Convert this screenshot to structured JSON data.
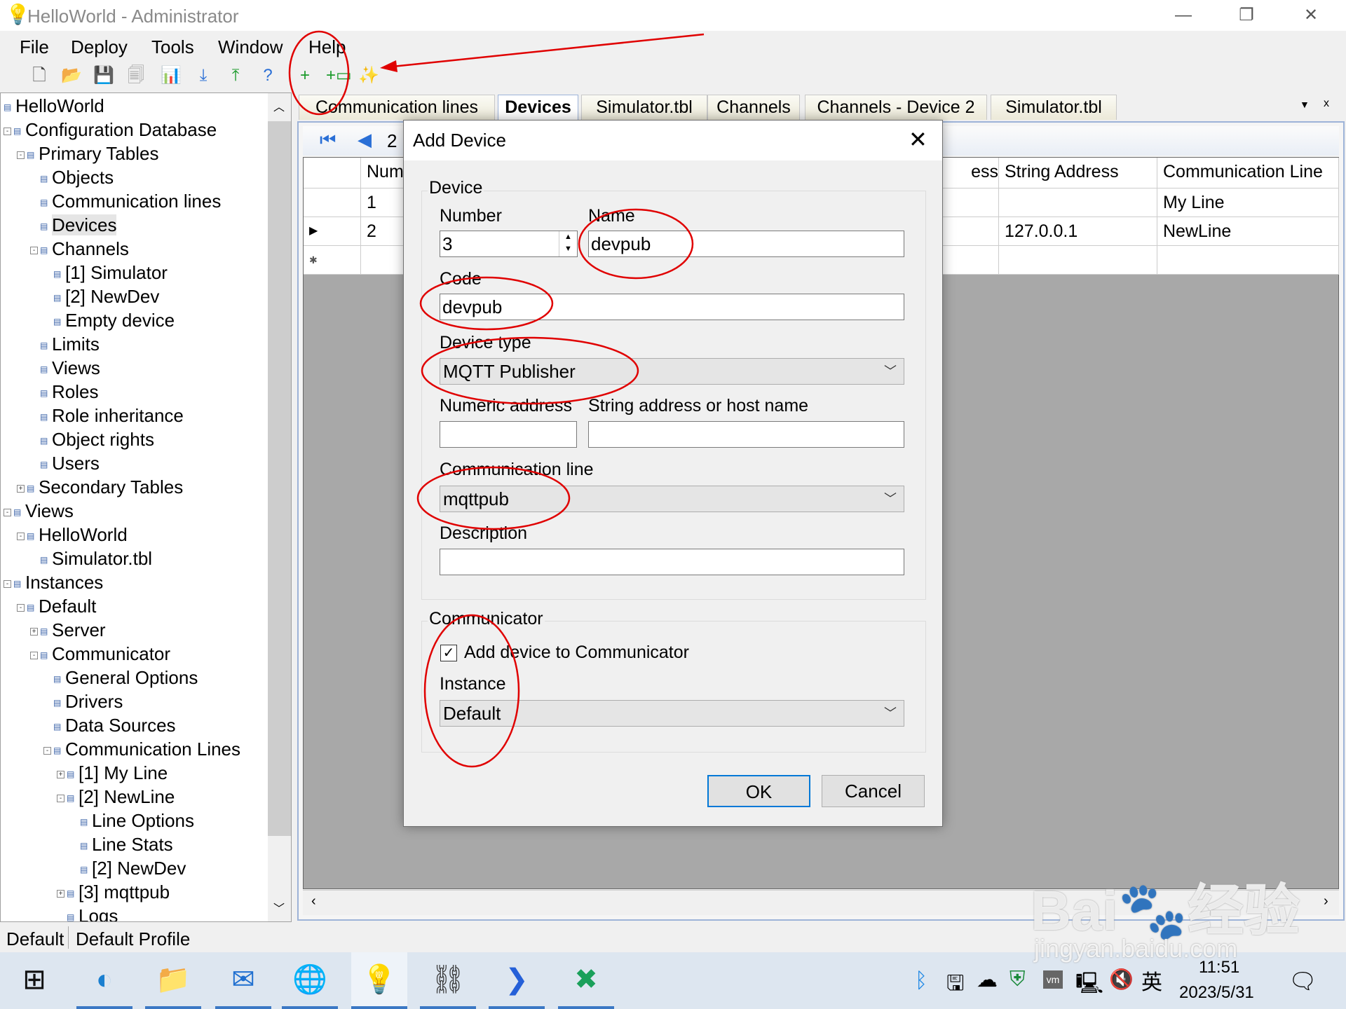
{
  "window": {
    "title": "HelloWorld - Administrator",
    "icon": "lightbulb-icon"
  },
  "menu": [
    "File",
    "Deploy",
    "Tools",
    "Window",
    "Help"
  ],
  "toolbar": [
    {
      "icon": "new-file-icon",
      "glyph": "🗋"
    },
    {
      "icon": "open-folder-icon",
      "glyph": "📂"
    },
    {
      "icon": "save-icon",
      "glyph": "💾"
    },
    {
      "icon": "save-all-icon",
      "glyph": "🗐"
    },
    {
      "icon": "chart-icon",
      "glyph": "📊"
    },
    {
      "icon": "download-icon",
      "glyph": "⤓"
    },
    {
      "icon": "upload-icon",
      "glyph": "⤒"
    },
    {
      "icon": "help-icon",
      "glyph": "?"
    },
    {
      "icon": "add-line-icon",
      "glyph": "+"
    },
    {
      "icon": "add-device-icon",
      "glyph": "+▭"
    },
    {
      "icon": "wizard-icon",
      "glyph": "✨"
    }
  ],
  "tree": [
    {
      "label": "HelloWorld",
      "level": 0,
      "exp": ""
    },
    {
      "label": "Configuration Database",
      "level": 0,
      "exp": "-"
    },
    {
      "label": "Primary Tables",
      "level": 1,
      "exp": "-"
    },
    {
      "label": "Objects",
      "level": 2,
      "exp": ""
    },
    {
      "label": "Communication lines",
      "level": 2,
      "exp": ""
    },
    {
      "label": "Devices",
      "level": 2,
      "exp": "",
      "selected": true
    },
    {
      "label": "Channels",
      "level": 2,
      "exp": "-"
    },
    {
      "label": "[1] Simulator",
      "level": 3,
      "exp": ""
    },
    {
      "label": "[2] NewDev",
      "level": 3,
      "exp": ""
    },
    {
      "label": "Empty device",
      "level": 3,
      "exp": ""
    },
    {
      "label": "Limits",
      "level": 2,
      "exp": ""
    },
    {
      "label": "Views",
      "level": 2,
      "exp": ""
    },
    {
      "label": "Roles",
      "level": 2,
      "exp": ""
    },
    {
      "label": "Role inheritance",
      "level": 2,
      "exp": ""
    },
    {
      "label": "Object rights",
      "level": 2,
      "exp": ""
    },
    {
      "label": "Users",
      "level": 2,
      "exp": ""
    },
    {
      "label": "Secondary Tables",
      "level": 1,
      "exp": "+"
    },
    {
      "label": "Views",
      "level": 0,
      "exp": "-"
    },
    {
      "label": "HelloWorld",
      "level": 1,
      "exp": "-"
    },
    {
      "label": "Simulator.tbl",
      "level": 2,
      "exp": ""
    },
    {
      "label": "Instances",
      "level": 0,
      "exp": "-"
    },
    {
      "label": "Default",
      "level": 1,
      "exp": "-"
    },
    {
      "label": "Server",
      "level": 2,
      "exp": "+"
    },
    {
      "label": "Communicator",
      "level": 2,
      "exp": "-"
    },
    {
      "label": "General Options",
      "level": 3,
      "exp": ""
    },
    {
      "label": "Drivers",
      "level": 3,
      "exp": ""
    },
    {
      "label": "Data Sources",
      "level": 3,
      "exp": ""
    },
    {
      "label": "Communication Lines",
      "level": 3,
      "exp": "-"
    },
    {
      "label": "[1] My Line",
      "level": 4,
      "exp": "+"
    },
    {
      "label": "[2] NewLine",
      "level": 4,
      "exp": "-"
    },
    {
      "label": "Line Options",
      "level": 5,
      "exp": ""
    },
    {
      "label": "Line Stats",
      "level": 5,
      "exp": ""
    },
    {
      "label": "[2] NewDev",
      "level": 5,
      "exp": ""
    },
    {
      "label": "[3] mqttpub",
      "level": 4,
      "exp": "+"
    },
    {
      "label": "Logs",
      "level": 4,
      "exp": ""
    }
  ],
  "tabs": [
    {
      "label": "Communication lines"
    },
    {
      "label": "Devices",
      "active": true
    },
    {
      "label": "Simulator.tbl"
    },
    {
      "label": "Channels"
    },
    {
      "label": "Channels - Device 2"
    },
    {
      "label": "Simulator.tbl"
    }
  ],
  "navigator": {
    "position": "2"
  },
  "grid": {
    "headers": [
      "Num",
      "ess",
      "String Address",
      "Communication Line"
    ],
    "rows": [
      [
        "1",
        "",
        "",
        "My Line"
      ],
      [
        "2",
        "",
        "127.0.0.1",
        "NewLine"
      ]
    ]
  },
  "dialog": {
    "title": "Add Device",
    "device_group": "Device",
    "number_label": "Number",
    "number_value": "3",
    "name_label": "Name",
    "name_value": "devpub",
    "code_label": "Code",
    "code_value": "devpub",
    "type_label": "Device type",
    "type_value": "MQTT Publisher",
    "numaddr_label": "Numeric address",
    "numaddr_value": "",
    "straddr_label": "String address or host name",
    "straddr_value": "",
    "commline_label": "Communication line",
    "commline_value": "mqttpub",
    "descr_label": "Description",
    "descr_value": "",
    "comm_group": "Communicator",
    "add_to_comm_label": "Add device to Communicator",
    "add_to_comm_checked": true,
    "instance_label": "Instance",
    "instance_value": "Default",
    "ok": "OK",
    "cancel": "Cancel"
  },
  "status": {
    "left": "Default",
    "right": "Default Profile"
  },
  "taskbar": {
    "apps": [
      "windows-start-icon",
      "edge-icon",
      "file-explorer-icon",
      "mail-icon",
      "network-app-icon",
      "scada-admin-icon",
      "network-diagram-icon",
      "powershell-icon",
      "xshell-icon"
    ],
    "time": "11:51",
    "date": "2023/5/31",
    "ime": "英"
  },
  "watermark": {
    "text": "Baidu经验",
    "url_text": "jingyan.baidu.com"
  },
  "annotation_color": "#e00000"
}
